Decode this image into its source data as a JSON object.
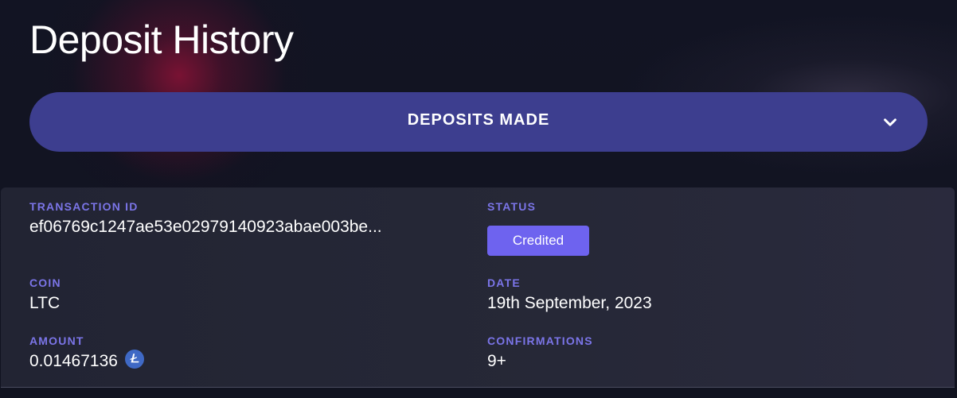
{
  "page": {
    "title": "Deposit History"
  },
  "filter": {
    "selected_label": "DEPOSITS MADE"
  },
  "transaction": {
    "transaction_id_label": "TRANSACTION ID",
    "transaction_id_value": "ef06769c1247ae53e02979140923abae003be...",
    "status_label": "STATUS",
    "status_value": "Credited",
    "coin_label": "COIN",
    "coin_value": "LTC",
    "date_label": "DATE",
    "date_value": "19th September, 2023",
    "amount_label": "AMOUNT",
    "amount_value": "0.01467136",
    "amount_icon": "litecoin-icon",
    "confirmations_label": "CONFIRMATIONS",
    "confirmations_value": "9+"
  },
  "colors": {
    "background": "#111320",
    "accent": "#3d3e8f",
    "label": "#7b75e8",
    "status_badge": "#6e63ef",
    "card_background": "#262837",
    "text": "#ffffff",
    "coin_icon": "#3f69c5"
  }
}
